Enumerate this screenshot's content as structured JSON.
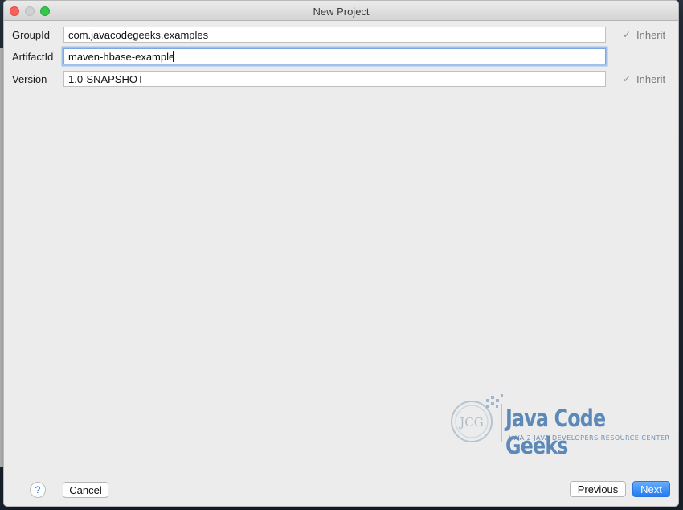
{
  "window": {
    "title": "New Project"
  },
  "form": {
    "group_id": {
      "label": "GroupId",
      "value": "com.javacodegeeks.examples",
      "inherit_checked": true,
      "inherit_label": "Inherit"
    },
    "artifact_id": {
      "label": "ArtifactId",
      "value": "maven-hbase-example"
    },
    "version": {
      "label": "Version",
      "value": "1.0-SNAPSHOT",
      "inherit_checked": true,
      "inherit_label": "Inherit"
    }
  },
  "logo": {
    "badge_text": "JCG",
    "name": "Java Code Geeks",
    "tagline": "JAVA 2 JAVA DEVELOPERS RESOURCE CENTER"
  },
  "footer": {
    "help_label": "?",
    "cancel_label": "Cancel",
    "previous_label": "Previous",
    "next_label": "Next"
  },
  "colors": {
    "accent": "#1d7cf2",
    "focus_ring": "#9fc1ee",
    "logo_blue": "#5d89b8"
  }
}
